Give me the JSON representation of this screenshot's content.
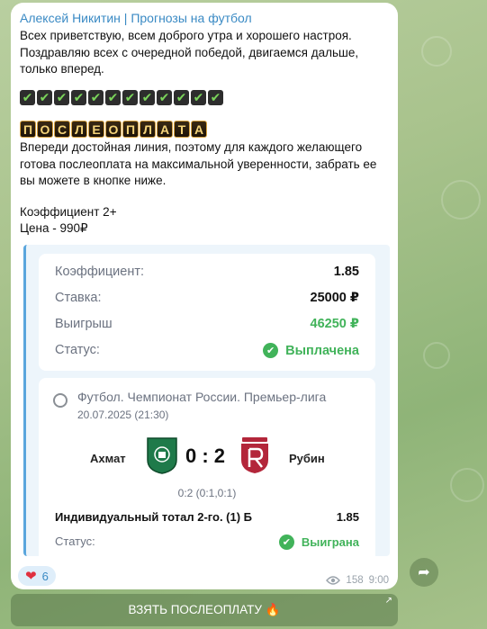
{
  "author": "Алексей Никитин | Прогнозы на футбол",
  "greeting": "Всех приветствую, всем доброго утра и хорошего настроя.\nПоздравляю всех с очередной победой, двигаемся дальше, только вперед.",
  "checks": [
    "✔",
    "✔",
    "✔",
    "✔",
    "✔",
    "✔",
    "✔",
    "✔",
    "✔",
    "✔",
    "✔",
    "✔"
  ],
  "tile_letters": [
    "П",
    "О",
    "С",
    "Л",
    "Е",
    "О",
    "П",
    "Л",
    "А",
    "Т",
    "А"
  ],
  "offer": "Впереди достойная линия, поэтому для каждого желающего готова послеоплата на максимальной уверенности, забрать ее вы можете в кнопке ниже.",
  "coef_line": "Коэффициент 2+",
  "price_line": "Цена - 990₽",
  "bet": {
    "coef_label": "Коэффициент:",
    "coef_value": "1.85",
    "stake_label": "Ставка:",
    "stake_value": "25000 ₽",
    "win_label": "Выигрыш",
    "win_value": "46250 ₽",
    "status_label": "Статус:",
    "status_value": "Выплачена"
  },
  "match": {
    "league": "Футбол. Чемпионат России. Премьер-лига",
    "date": "20.07.2025 (21:30)",
    "home": "Ахмат",
    "away": "Рубин",
    "score": "0 : 2",
    "halves": "0:2 (0:1,0:1)",
    "market": "Индивидуальный тотал 2-го. (1) Б",
    "market_coef": "1.85",
    "status_label": "Статус:",
    "status_value": "Выиграна"
  },
  "reaction": {
    "emoji": "❤",
    "count": "6"
  },
  "views": "158",
  "time": "9:00",
  "button": "ВЗЯТЬ ПОСЛЕОПЛАТУ 🔥",
  "colors": {
    "accent": "#3a8ac4",
    "win": "#41b35a",
    "akhmat": "#1f7a4a",
    "rubin": "#b3263a"
  }
}
